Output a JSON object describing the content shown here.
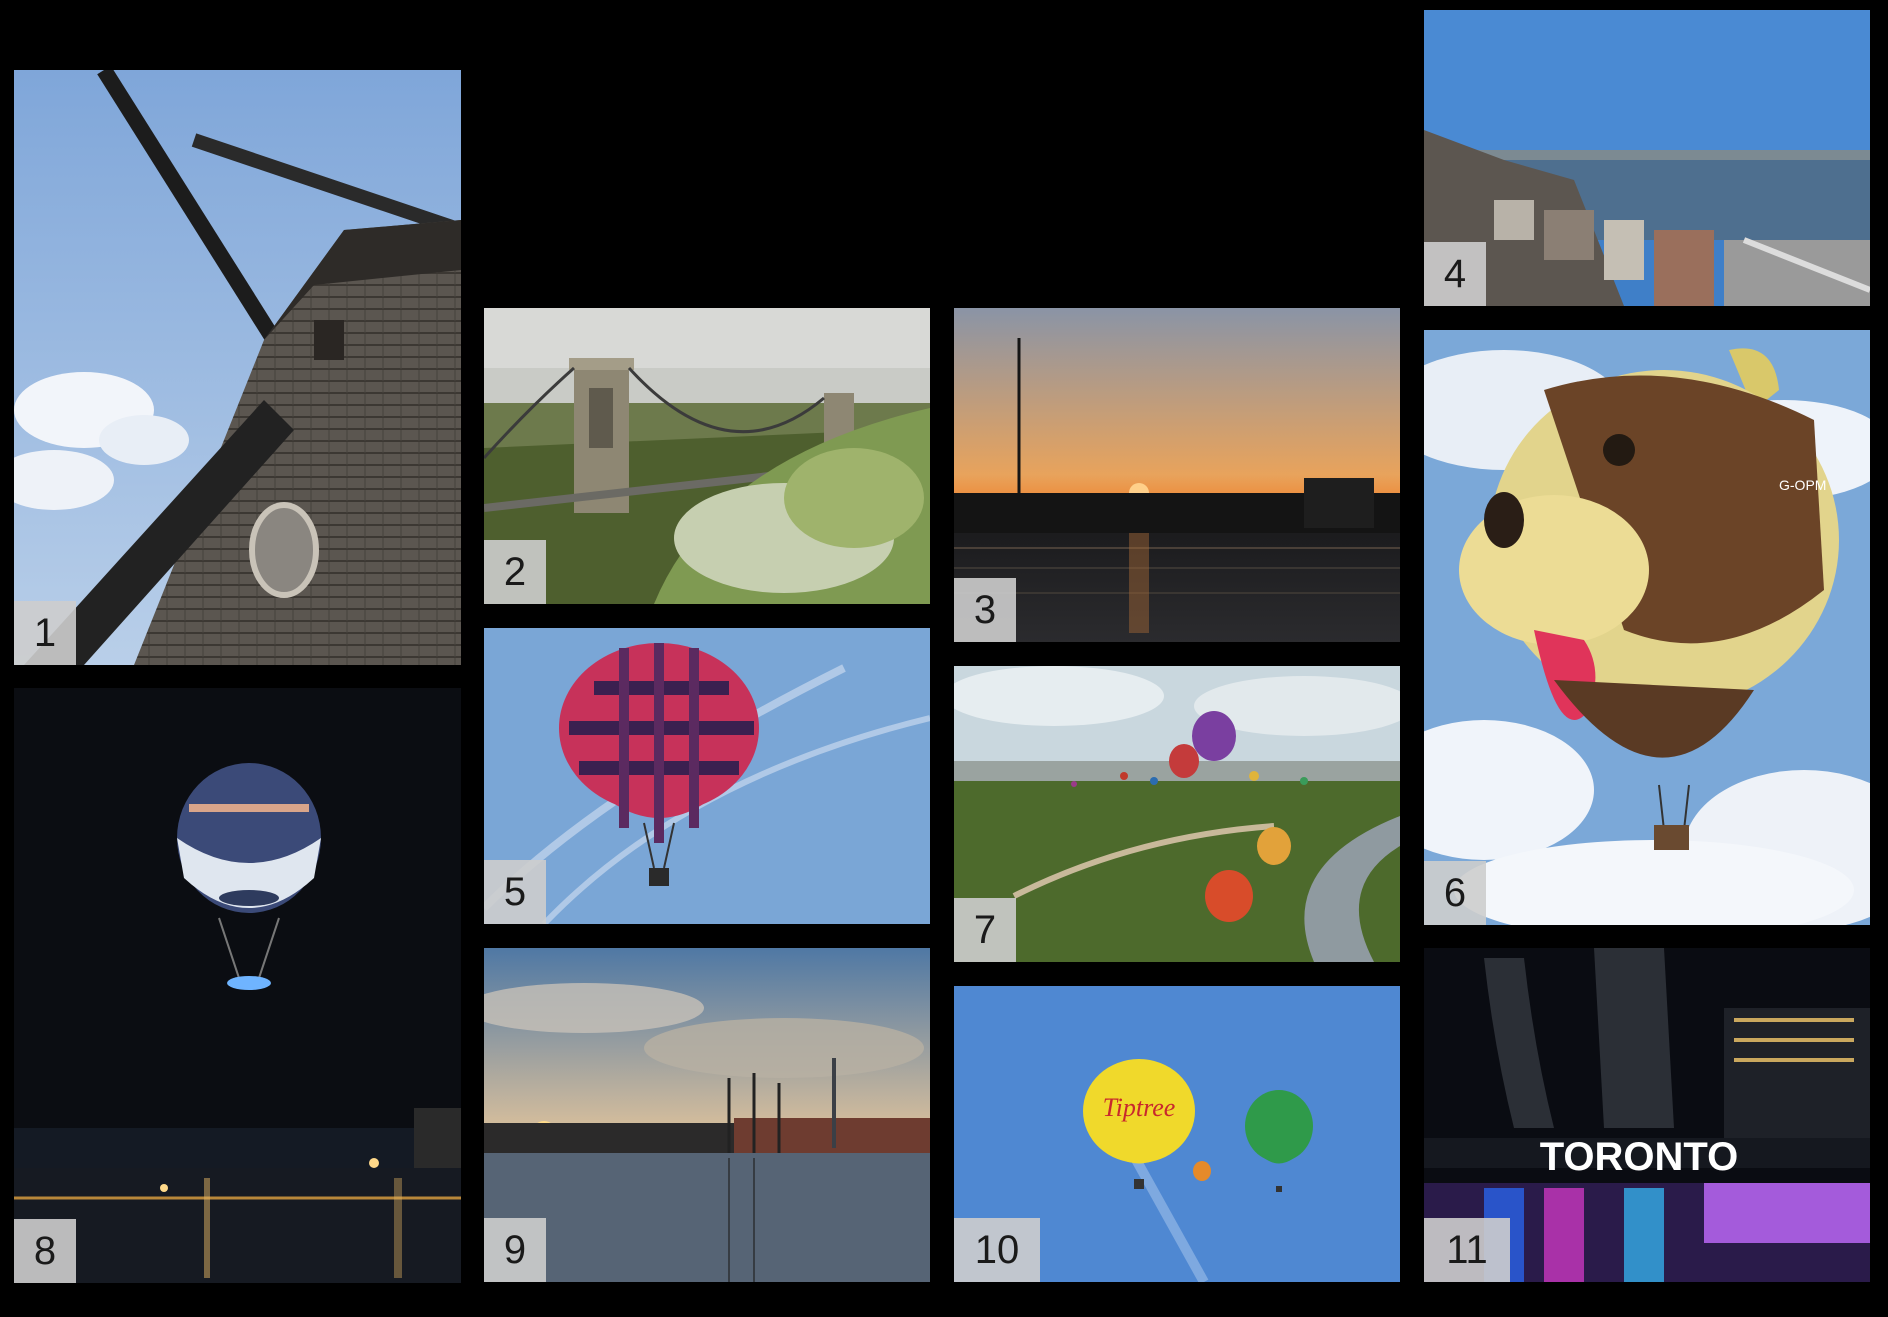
{
  "photos": [
    {
      "id": "windmill",
      "label": "1"
    },
    {
      "id": "suspension-bridge",
      "label": "2"
    },
    {
      "id": "marina-sunset",
      "label": "3"
    },
    {
      "id": "coastal-city",
      "label": "4"
    },
    {
      "id": "pink-hot-air-balloon",
      "label": "5"
    },
    {
      "id": "dog-shaped-balloon",
      "label": "6"
    },
    {
      "id": "balloon-fiesta",
      "label": "7"
    },
    {
      "id": "night-balloon",
      "label": "8"
    },
    {
      "id": "tall-ship-harbor",
      "label": "9"
    },
    {
      "id": "tiptree-balloons",
      "label": "10"
    },
    {
      "id": "toronto-sign",
      "label": "11"
    }
  ],
  "signs": {
    "toronto": "TORONTO",
    "balloon_brand": "Tiptree",
    "balloon_registration": "G-OPM"
  },
  "colors": {
    "background": "#000000",
    "badge": "#cdcdcd",
    "badge_text": "#1a1a1a"
  }
}
